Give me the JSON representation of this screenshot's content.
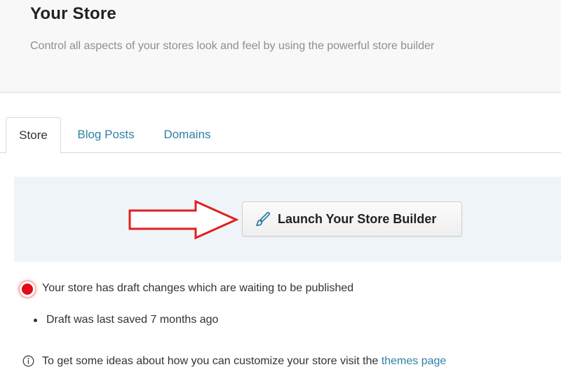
{
  "header": {
    "title": "Your Store",
    "subtitle": "Control all aspects of your stores look and feel by using the powerful store builder"
  },
  "tabs": [
    {
      "label": "Store",
      "active": true
    },
    {
      "label": "Blog Posts",
      "active": false
    },
    {
      "label": "Domains",
      "active": false
    }
  ],
  "builder": {
    "button_label": "Launch Your Store Builder",
    "button_icon": "paintbrush-icon",
    "annotation": "red-arrow"
  },
  "status": {
    "message": "Your store has draft changes which are waiting to be published",
    "indicator_color": "#e30b17",
    "draft_note": "Draft was last saved 7 months ago"
  },
  "info": {
    "icon": "info-icon",
    "text_before_link": "To get some ideas about how you can customize your store visit the ",
    "link_text": "themes page"
  },
  "colors": {
    "link": "#2f80a6",
    "panel_bg": "#eff4f8",
    "arrow": "#e02020"
  }
}
